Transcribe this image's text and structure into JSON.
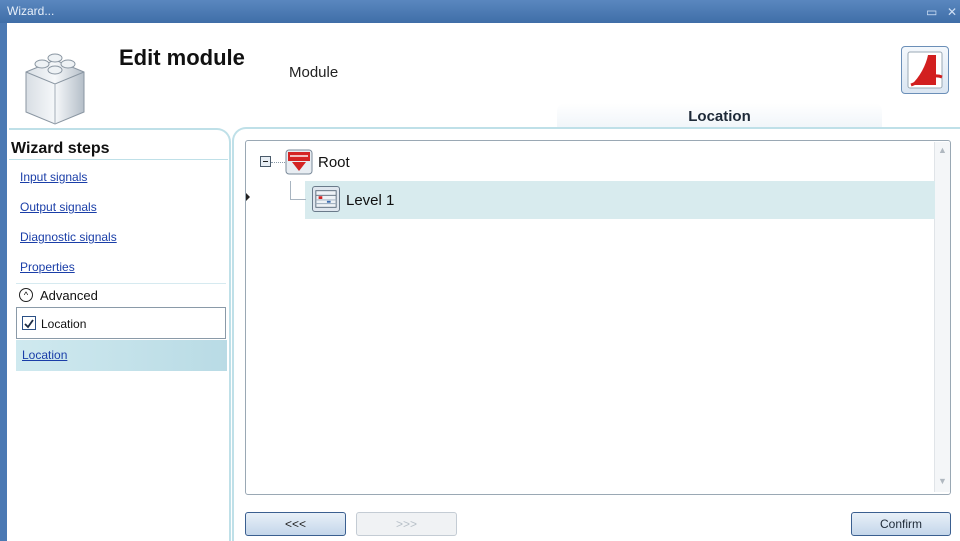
{
  "window": {
    "title": "Wizard...",
    "restore_icon": "restore-icon",
    "close_icon": "close-icon"
  },
  "header": {
    "title": "Edit module",
    "subtitle": "Module",
    "tab_label": "Location"
  },
  "steps": {
    "title": "Wizard steps",
    "links": [
      {
        "label": "Input signals"
      },
      {
        "label": "Output signals"
      },
      {
        "label": "Diagnostic signals"
      },
      {
        "label": "Properties"
      }
    ],
    "advanced_label": "Advanced",
    "location_checkbox_label": "Location",
    "location_checked": true,
    "selected_link": "Location"
  },
  "tree": {
    "nodes": [
      {
        "label": "Root",
        "icon": "root-node-icon",
        "expanded": true
      },
      {
        "label": "Level 1",
        "icon": "level-node-icon",
        "selected": true
      }
    ]
  },
  "buttons": {
    "back": "<<<",
    "next": ">>>",
    "confirm": "Confirm"
  },
  "colors": {
    "titlebar": "#4b79b3",
    "selection": "#d8ebee",
    "panel_border": "#bfe0e8",
    "link": "#1a3ea8"
  }
}
